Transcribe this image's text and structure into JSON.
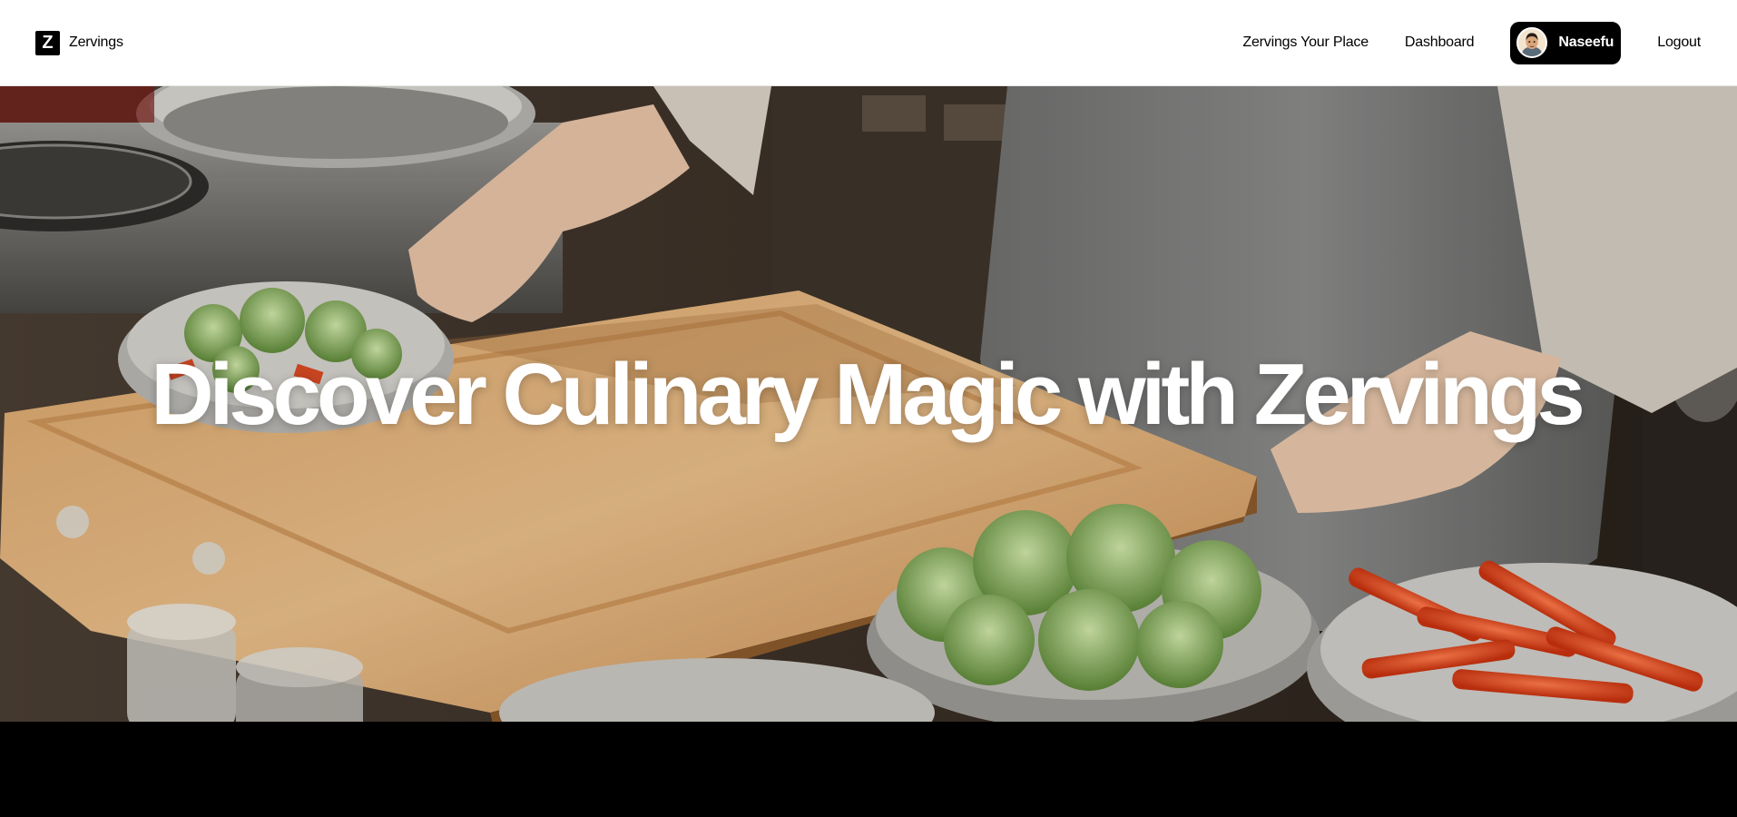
{
  "header": {
    "brand_mark": "Z",
    "brand_name": "Zervings",
    "nav": {
      "place_label": "Zervings Your Place",
      "dashboard_label": "Dashboard",
      "user_name": "Naseefu",
      "logout_label": "Logout"
    }
  },
  "hero": {
    "title": "Discover Culinary Magic with Zervings",
    "background_image": "chef-kitchen-photo"
  },
  "colors": {
    "header_bg": "#ffffff",
    "user_pill_bg": "#000000",
    "hero_text": "#ffffff",
    "page_bg": "#000000"
  }
}
